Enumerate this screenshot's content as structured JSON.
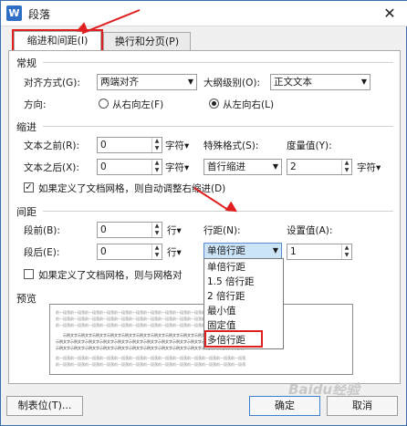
{
  "window": {
    "title": "段落",
    "app_icon": "W",
    "close": "✕"
  },
  "tabs": [
    {
      "label": "缩进和间距(I)"
    },
    {
      "label": "换行和分页(P)"
    }
  ],
  "general": {
    "section": "常规",
    "alignment_label": "对齐方式(G):",
    "alignment_value": "两端对齐",
    "outline_label": "大纲级别(O):",
    "outline_value": "正文文本",
    "direction_label": "方向:",
    "rtl_label": "从右向左(F)",
    "ltr_label": "从左向右(L)"
  },
  "indent": {
    "section": "缩进",
    "before_label": "文本之前(R):",
    "before_value": "0",
    "before_unit": "字符▾",
    "after_label": "文本之后(X):",
    "after_value": "0",
    "after_unit": "字符▾",
    "special_label": "特殊格式(S):",
    "special_value": "首行缩进",
    "measure_label": "度量值(Y):",
    "measure_value": "2",
    "measure_unit": "字符▾",
    "grid_check_label": "如果定义了文档网格，则自动调整右缩进(D)"
  },
  "spacing": {
    "section": "间距",
    "before_label": "段前(B):",
    "before_value": "0",
    "before_unit": "行▾",
    "after_label": "段后(E):",
    "after_value": "0",
    "after_unit": "行▾",
    "line_label": "行距(N):",
    "line_value": "单倍行距",
    "setting_label": "设置值(A):",
    "setting_value": "1",
    "grid_check_label": "如果定义了文档网格，则与网格对"
  },
  "line_spacing_options": [
    "单倍行距",
    "1.5 倍行距",
    "2 倍行距",
    "最小值",
    "固定值",
    "多倍行距"
  ],
  "preview": {
    "section": "预览",
    "sample_text": "前一段落前一段落前一段落前一段落前一段落前一段落前一段落前一段落前一段落前一段落前一段落前一段落前一段落",
    "current_text": "示例文字示例文字示例文字示例文字示例文字示例文字示例文字示例文字示例文字示例文字示例文字示例文字示例文字"
  },
  "buttons": {
    "tabs": "制表位(T)...",
    "ok": "确定",
    "cancel": "取消"
  },
  "watermark": "Baidu经验",
  "colors": {
    "highlight": "#e02020",
    "title_bar": "#ffffff",
    "app_icon": "#2f6fc6",
    "selection": "#cce4f7"
  }
}
